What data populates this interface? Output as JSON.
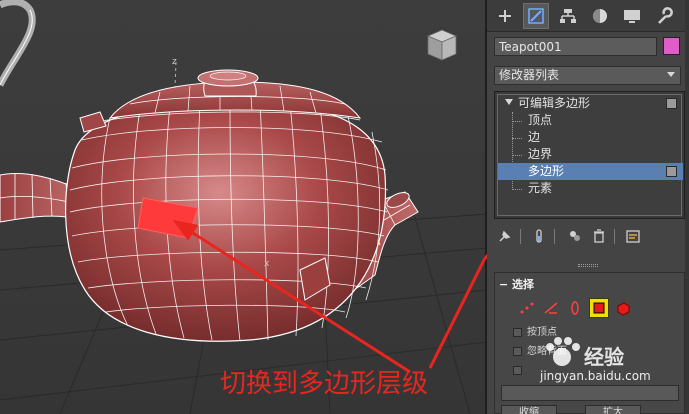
{
  "viewport": {
    "name": "perspective-viewport",
    "object": "teapot",
    "wire_color": "#ffffff",
    "object_color": "#b54a4a",
    "highlight_color": "#ff3333"
  },
  "tabs": [
    {
      "name": "create",
      "icon": "plus-icon"
    },
    {
      "name": "modify",
      "icon": "modify-icon",
      "active": true
    },
    {
      "name": "hierarchy",
      "icon": "hierarchy-icon"
    },
    {
      "name": "motion",
      "icon": "motion-icon"
    },
    {
      "name": "display",
      "icon": "display-icon"
    },
    {
      "name": "utilities",
      "icon": "wrench-icon"
    }
  ],
  "object_name": "Teapot001",
  "object_color": "#e05cc7",
  "modifier_list_label": "修改器列表",
  "stack": {
    "root": "可编辑多边形",
    "items": [
      "顶点",
      "边",
      "边界",
      "多边形",
      "元素"
    ],
    "selected_index": 3
  },
  "selection_rollout": {
    "title": "选择",
    "checkboxes": [
      "按顶点",
      "忽略背面"
    ],
    "buttons": [
      "收缩",
      "扩大"
    ]
  },
  "annotation_text": "切换到多边形层级",
  "watermark": {
    "text": "经验",
    "url": "jingyan.baidu.com"
  },
  "accent_color": "#5a7fb3",
  "annotation_color": "#e8261f"
}
